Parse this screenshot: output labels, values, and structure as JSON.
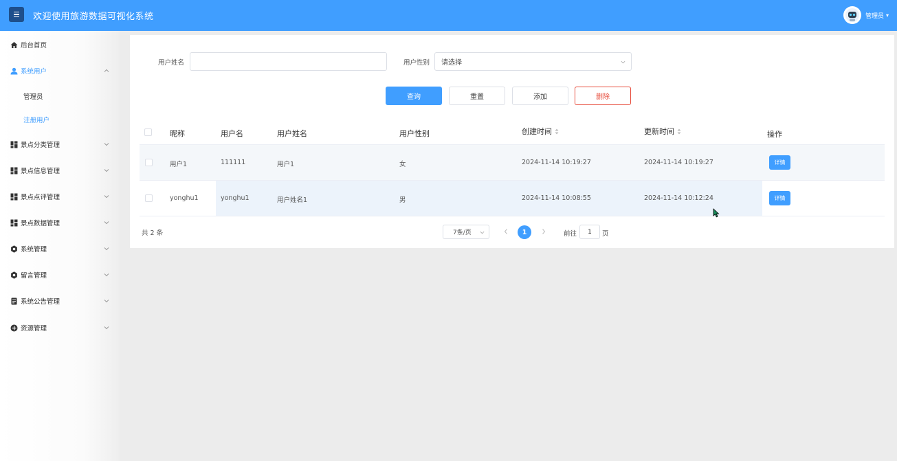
{
  "header": {
    "title": "欢迎使用旅游数据可视化系统",
    "user_name": "管理员",
    "background": "#409eff"
  },
  "sidebar": {
    "items": [
      {
        "label": "后台首页",
        "icon": "home-icon"
      },
      {
        "label": "系统用户",
        "icon": "user-icon",
        "expanded": true,
        "active": true,
        "children": [
          {
            "label": "管理员"
          },
          {
            "label": "注册用户",
            "active": true
          }
        ]
      },
      {
        "label": "景点分类管理",
        "icon": "grid-icon"
      },
      {
        "label": "景点信息管理",
        "icon": "grid-icon"
      },
      {
        "label": "景点点评管理",
        "icon": "grid-icon"
      },
      {
        "label": "景点数据管理",
        "icon": "grid-icon"
      },
      {
        "label": "系统管理",
        "icon": "gear-icon"
      },
      {
        "label": "留言管理",
        "icon": "gear-icon"
      },
      {
        "label": "系统公告管理",
        "icon": "document-icon"
      },
      {
        "label": "资源管理",
        "icon": "plus-circle-icon"
      }
    ]
  },
  "search": {
    "name_label": "用户姓名",
    "name_value": "",
    "gender_label": "用户性别",
    "gender_placeholder": "请选择"
  },
  "buttons": {
    "query": "查询",
    "reset": "重置",
    "add": "添加",
    "delete": "删除"
  },
  "table": {
    "columns": [
      "昵称",
      "用户名",
      "用户姓名",
      "用户性别",
      "创建时间",
      "更新时间",
      "操作"
    ],
    "rows": [
      {
        "nickname": "用户1",
        "username": "111111",
        "real_name": "用户1",
        "gender": "女",
        "created": "2024-11-14 10:19:27",
        "updated": "2024-11-14 10:19:27",
        "action": "详情"
      },
      {
        "nickname": "yonghu1",
        "username": "yonghu1",
        "real_name": "用户姓名1",
        "gender": "男",
        "created": "2024-11-14 10:08:55",
        "updated": "2024-11-14 10:12:24",
        "action": "详情"
      }
    ]
  },
  "pagination": {
    "total": "共 2 条",
    "page_size": "7条/页",
    "current_page": "1",
    "goto_label": "前往",
    "goto_value": "1",
    "page_suffix": "页"
  }
}
